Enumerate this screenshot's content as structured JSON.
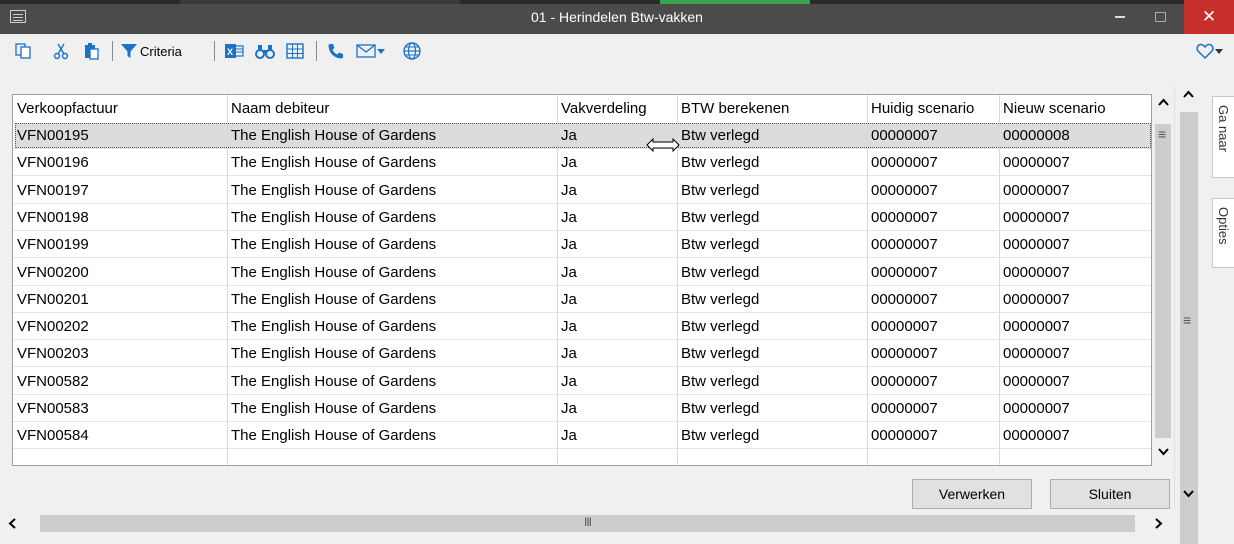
{
  "window": {
    "title": "01 - Herindelen Btw-vakken",
    "close_glyph": "✕"
  },
  "toolbar": {
    "criteria_label": "Criteria",
    "icons": [
      "copy-icon",
      "cut-icon",
      "paste-icon",
      "filter-icon",
      "excel-icon",
      "binoculars-icon",
      "grid-icon",
      "phone-icon",
      "mail-icon",
      "globe-icon",
      "favorite-icon"
    ],
    "accent": "#1a73c8"
  },
  "table": {
    "headers": [
      "Verkoopfactuur",
      "Naam debiteur",
      "Vakverdeling",
      "BTW berekenen",
      "Huidig scenario",
      "Nieuw scenario"
    ],
    "rows": [
      [
        "VFN00195",
        "The English House of Gardens",
        "Ja",
        "Btw verlegd",
        "00000007",
        "00000008"
      ],
      [
        "VFN00196",
        "The English House of Gardens",
        "Ja",
        "Btw verlegd",
        "00000007",
        "00000007"
      ],
      [
        "VFN00197",
        "The English House of Gardens",
        "Ja",
        "Btw verlegd",
        "00000007",
        "00000007"
      ],
      [
        "VFN00198",
        "The English House of Gardens",
        "Ja",
        "Btw verlegd",
        "00000007",
        "00000007"
      ],
      [
        "VFN00199",
        "The English House of Gardens",
        "Ja",
        "Btw verlegd",
        "00000007",
        "00000007"
      ],
      [
        "VFN00200",
        "The English House of Gardens",
        "Ja",
        "Btw verlegd",
        "00000007",
        "00000007"
      ],
      [
        "VFN00201",
        "The English House of Gardens",
        "Ja",
        "Btw verlegd",
        "00000007",
        "00000007"
      ],
      [
        "VFN00202",
        "The English House of Gardens",
        "Ja",
        "Btw verlegd",
        "00000007",
        "00000007"
      ],
      [
        "VFN00203",
        "The English House of Gardens",
        "Ja",
        "Btw verlegd",
        "00000007",
        "00000007"
      ],
      [
        "VFN00582",
        "The English House of Gardens",
        "Ja",
        "Btw verlegd",
        "00000007",
        "00000007"
      ],
      [
        "VFN00583",
        "The English House of Gardens",
        "Ja",
        "Btw verlegd",
        "00000007",
        "00000007"
      ],
      [
        "VFN00584",
        "The English House of Gardens",
        "Ja",
        "Btw verlegd",
        "00000007",
        "00000007"
      ]
    ],
    "selected_row": 0
  },
  "side_tabs": {
    "goto": "Ga naar",
    "options": "Opties"
  },
  "buttons": {
    "process": "Verwerken",
    "close": "Sluiten"
  },
  "scroll": {
    "h_thumb_grip": "III",
    "v_grip": "≡"
  }
}
